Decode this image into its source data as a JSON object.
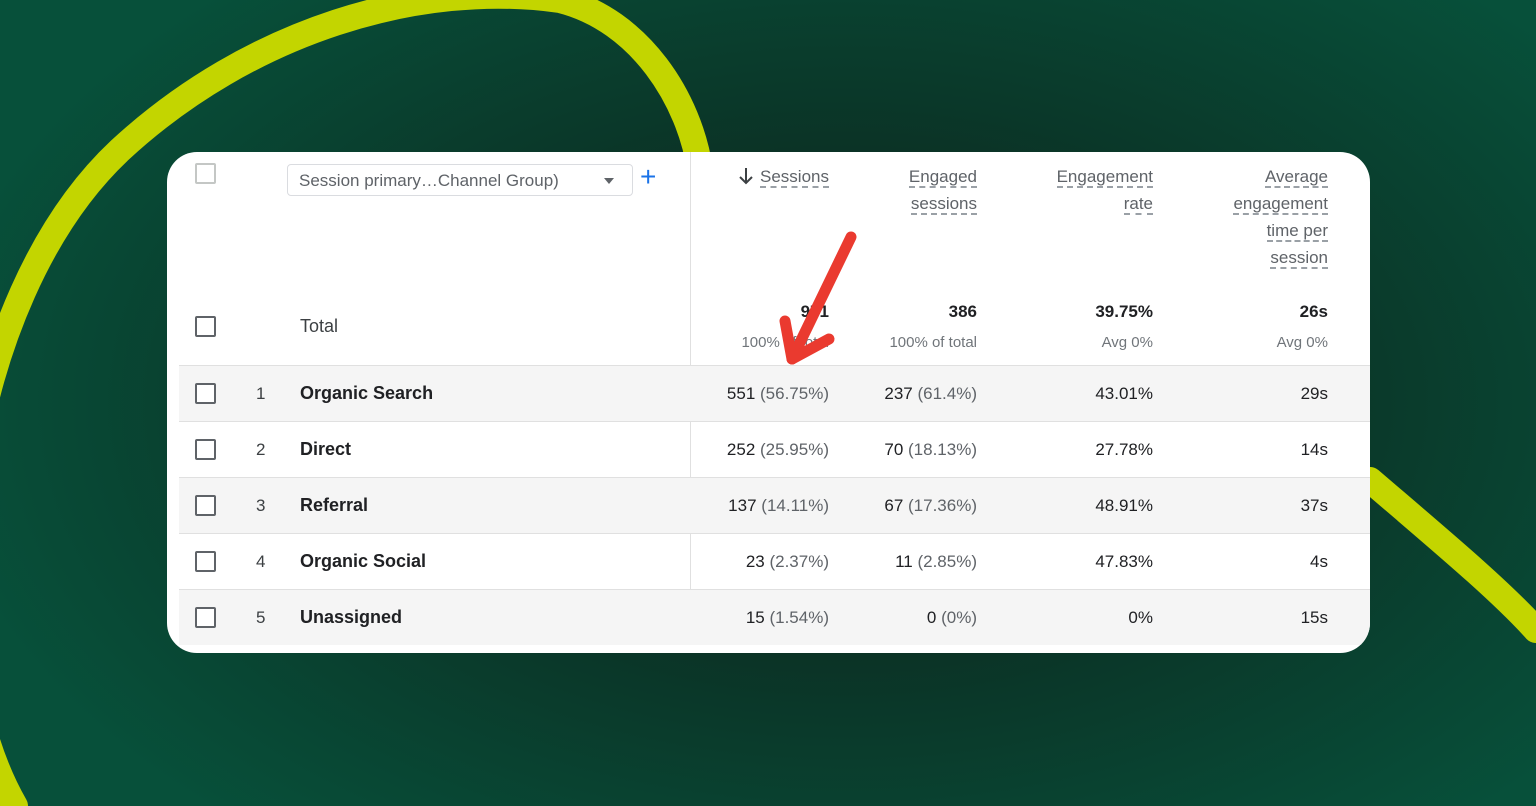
{
  "colors": {
    "background_dark": "#0b3326",
    "swoosh": "#c3d500",
    "card": "#ffffff",
    "accent_blue": "#1a73e8",
    "annotation_arrow": "#ea3a2f"
  },
  "table": {
    "dimension_selector": "Session primary…Channel Group)",
    "add_dimension_label": "+",
    "sort_icon": "arrow-down-icon",
    "columns": [
      {
        "label_lines": [
          "Sessions"
        ]
      },
      {
        "label_lines": [
          "Engaged",
          "sessions"
        ]
      },
      {
        "label_lines": [
          "Engagement",
          "rate"
        ]
      },
      {
        "label_lines": [
          "Average",
          "engagement",
          "time per",
          "session"
        ]
      }
    ],
    "total": {
      "label": "Total",
      "sessions": "971",
      "sessions_sub": "100% of total",
      "engaged": "386",
      "engaged_sub": "100% of total",
      "rate": "39.75%",
      "rate_sub": "Avg 0%",
      "time": "26s",
      "time_sub": "Avg 0%"
    },
    "rows": [
      {
        "rank": "1",
        "channel": "Organic Search",
        "sessions": "551",
        "sessions_pct": "(56.75%)",
        "engaged": "237",
        "engaged_pct": "(61.4%)",
        "rate": "43.01%",
        "time": "29s"
      },
      {
        "rank": "2",
        "channel": "Direct",
        "sessions": "252",
        "sessions_pct": "(25.95%)",
        "engaged": "70",
        "engaged_pct": "(18.13%)",
        "rate": "27.78%",
        "time": "14s"
      },
      {
        "rank": "3",
        "channel": "Referral",
        "sessions": "137",
        "sessions_pct": "(14.11%)",
        "engaged": "67",
        "engaged_pct": "(17.36%)",
        "rate": "48.91%",
        "time": "37s"
      },
      {
        "rank": "4",
        "channel": "Organic Social",
        "sessions": "23",
        "sessions_pct": "(2.37%)",
        "engaged": "11",
        "engaged_pct": "(2.85%)",
        "rate": "47.83%",
        "time": "4s"
      },
      {
        "rank": "5",
        "channel": "Unassigned",
        "sessions": "15",
        "sessions_pct": "(1.54%)",
        "engaged": "0",
        "engaged_pct": "(0%)",
        "rate": "0%",
        "time": "15s"
      }
    ]
  }
}
